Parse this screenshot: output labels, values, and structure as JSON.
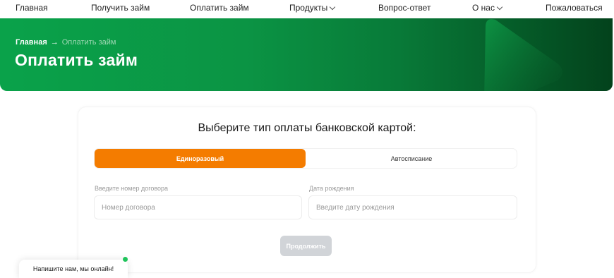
{
  "nav": {
    "items": [
      {
        "label": "Главная",
        "has_dropdown": false
      },
      {
        "label": "Получить займ",
        "has_dropdown": false
      },
      {
        "label": "Оплатить займ",
        "has_dropdown": false
      },
      {
        "label": "Продукты",
        "has_dropdown": true
      },
      {
        "label": "Вопрос-ответ",
        "has_dropdown": false
      },
      {
        "label": "О нас",
        "has_dropdown": true
      },
      {
        "label": "Пожаловаться",
        "has_dropdown": false
      }
    ]
  },
  "hero": {
    "breadcrumb_home": "Главная",
    "breadcrumb_current": "Оплатить займ",
    "title": "Оплатить займ",
    "gradient_start": "#0aa24a",
    "gradient_end": "#03421c"
  },
  "payment": {
    "heading": "Выберите тип оплаты банковской картой:",
    "tabs": [
      {
        "label": "Единоразовый",
        "active": true
      },
      {
        "label": "Автосписание",
        "active": false
      }
    ],
    "accent_color": "#f47c00",
    "contract_label": "Введите номер договора",
    "contract_placeholder": "Номер договора",
    "contract_value": "",
    "birthdate_label": "Дата рождения",
    "birthdate_placeholder": "Введите дату рождения",
    "birthdate_value": "",
    "submit_label": "Продолжить",
    "submit_enabled": false
  },
  "chat": {
    "label": "Напишите нам, мы онлайн!",
    "status": "online",
    "status_color": "#1fc45b"
  }
}
